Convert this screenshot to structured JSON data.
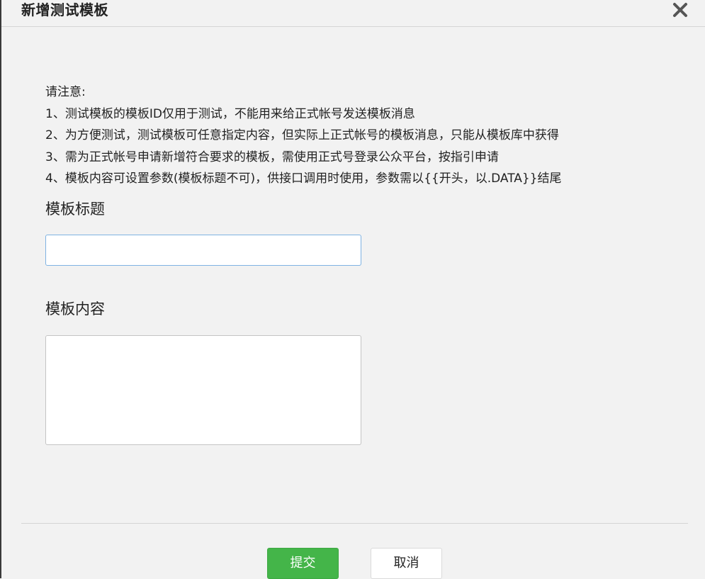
{
  "dialog": {
    "title": "新增测试模板"
  },
  "notice": {
    "heading": "请注意:",
    "lines": [
      "1、测试模板的模板ID仅用于测试，不能用来给正式帐号发送模板消息",
      "2、为方便测试，测试模板可任意指定内容，但实际上正式帐号的模板消息，只能从模板库中获得",
      "3、需为正式帐号申请新增符合要求的模板，需使用正式号登录公众平台，按指引申请",
      "4、模板内容可设置参数(模板标题不可)，供接口调用时使用，参数需以{{开头，以.DATA}}结尾"
    ]
  },
  "form": {
    "title_label": "模板标题",
    "title_value": "",
    "content_label": "模板内容",
    "content_value": ""
  },
  "footer": {
    "submit_label": "提交",
    "cancel_label": "取消"
  },
  "colors": {
    "submit_bg": "#44b549",
    "input_focus_border": "#7fb3e3",
    "dialog_bg": "#f2f2f2"
  },
  "icons": {
    "close": "close-icon"
  }
}
